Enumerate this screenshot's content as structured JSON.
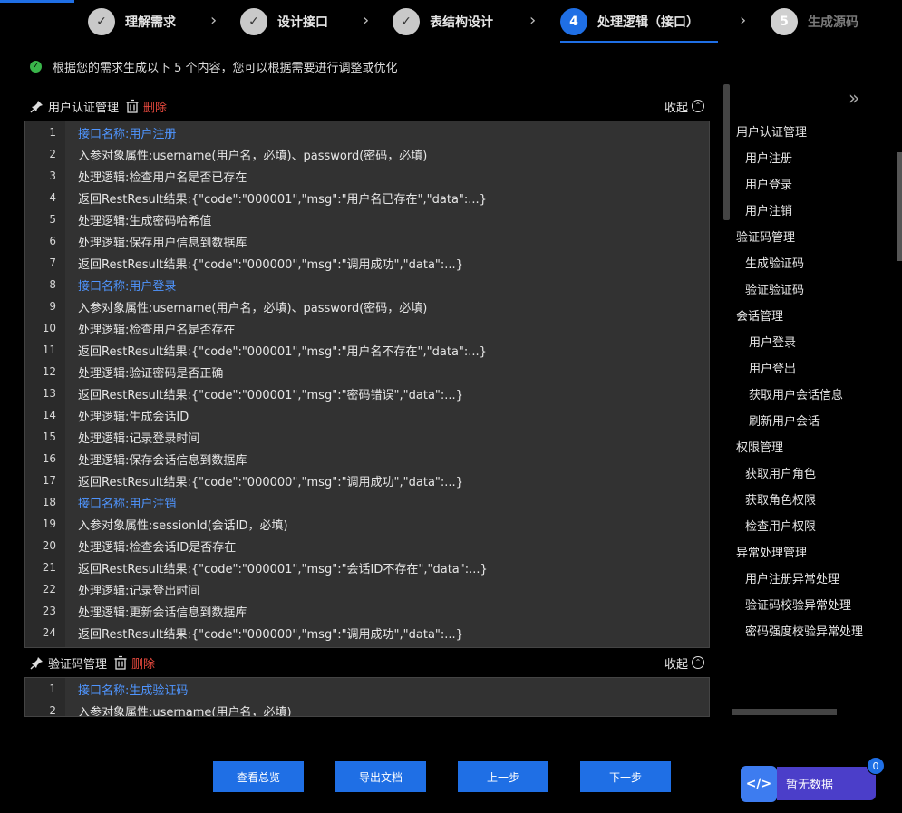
{
  "steps": [
    {
      "label": "理解需求",
      "state": "done"
    },
    {
      "label": "设计接口",
      "state": "done"
    },
    {
      "label": "表结构设计",
      "state": "done"
    },
    {
      "label": "处理逻辑（接口）",
      "state": "active",
      "number": "4"
    },
    {
      "label": "生成源码",
      "state": "todo",
      "number": "5"
    }
  ],
  "info": "根据您的需求生成以下 5 个内容，您可以根据需要进行调整或优化",
  "sections": [
    {
      "title": "用户认证管理",
      "delete_label": "删除",
      "collapse_label": "收起",
      "lines": [
        {
          "n": "1",
          "text": "接口名称:用户注册",
          "blue": true
        },
        {
          "n": "2",
          "text": "入参对象属性:username(用户名，必填)、password(密码，必填)"
        },
        {
          "n": "3",
          "text": "处理逻辑:检查用户名是否已存在"
        },
        {
          "n": "4",
          "text": "返回RestResult结果:{\"code\":\"000001\",\"msg\":\"用户名已存在\",\"data\":...}"
        },
        {
          "n": "5",
          "text": "处理逻辑:生成密码哈希值"
        },
        {
          "n": "6",
          "text": "处理逻辑:保存用户信息到数据库"
        },
        {
          "n": "7",
          "text": "返回RestResult结果:{\"code\":\"000000\",\"msg\":\"调用成功\",\"data\":...}"
        },
        {
          "n": "8",
          "text": "接口名称:用户登录",
          "blue": true
        },
        {
          "n": "9",
          "text": "入参对象属性:username(用户名，必填)、password(密码，必填)"
        },
        {
          "n": "10",
          "text": "处理逻辑:检查用户名是否存在"
        },
        {
          "n": "11",
          "text": "返回RestResult结果:{\"code\":\"000001\",\"msg\":\"用户名不存在\",\"data\":...}"
        },
        {
          "n": "12",
          "text": "处理逻辑:验证密码是否正确"
        },
        {
          "n": "13",
          "text": "返回RestResult结果:{\"code\":\"000001\",\"msg\":\"密码错误\",\"data\":...}"
        },
        {
          "n": "14",
          "text": "处理逻辑:生成会话ID"
        },
        {
          "n": "15",
          "text": "处理逻辑:记录登录时间"
        },
        {
          "n": "16",
          "text": "处理逻辑:保存会话信息到数据库"
        },
        {
          "n": "17",
          "text": "返回RestResult结果:{\"code\":\"000000\",\"msg\":\"调用成功\",\"data\":...}"
        },
        {
          "n": "18",
          "text": "接口名称:用户注销",
          "blue": true
        },
        {
          "n": "19",
          "text": "入参对象属性:sessionId(会话ID，必填)"
        },
        {
          "n": "20",
          "text": "处理逻辑:检查会话ID是否存在"
        },
        {
          "n": "21",
          "text": "返回RestResult结果:{\"code\":\"000001\",\"msg\":\"会话ID不存在\",\"data\":...}"
        },
        {
          "n": "22",
          "text": "处理逻辑:记录登出时间"
        },
        {
          "n": "23",
          "text": "处理逻辑:更新会话信息到数据库"
        },
        {
          "n": "24",
          "text": "返回RestResult结果:{\"code\":\"000000\",\"msg\":\"调用成功\",\"data\":...}"
        }
      ]
    },
    {
      "title": "验证码管理",
      "delete_label": "删除",
      "collapse_label": "收起",
      "lines": [
        {
          "n": "1",
          "text": "接口名称:生成验证码",
          "blue": true
        },
        {
          "n": "2",
          "text": "入参对象属性:username(用户名，必填)"
        }
      ]
    }
  ],
  "outline": [
    {
      "text": "用户认证管理",
      "level": 1
    },
    {
      "text": "用户注册",
      "level": 2
    },
    {
      "text": "用户登录",
      "level": 2
    },
    {
      "text": "用户注销",
      "level": 2
    },
    {
      "text": "验证码管理",
      "level": 1
    },
    {
      "text": "生成验证码",
      "level": 2
    },
    {
      "text": "验证验证码",
      "level": 2
    },
    {
      "text": "会话管理",
      "level": 1
    },
    {
      "text": "用户登录",
      "level": 3
    },
    {
      "text": "用户登出",
      "level": 3
    },
    {
      "text": "获取用户会话信息",
      "level": 3
    },
    {
      "text": "刷新用户会话",
      "level": 3
    },
    {
      "text": "权限管理",
      "level": 1
    },
    {
      "text": "获取用户角色",
      "level": 2
    },
    {
      "text": "获取角色权限",
      "level": 2
    },
    {
      "text": "检查用户权限",
      "level": 2
    },
    {
      "text": "异常处理管理",
      "level": 1
    },
    {
      "text": "用户注册异常处理",
      "level": 2
    },
    {
      "text": "验证码校验异常处理",
      "level": 2
    },
    {
      "text": "密码强度校验异常处理",
      "level": 2
    }
  ],
  "buttons": {
    "overview": "查看总览",
    "export": "导出文档",
    "prev": "上一步",
    "next": "下一步"
  },
  "widget": {
    "label": "暂无数据",
    "badge": "0",
    "icon": "code-icon"
  },
  "colors": {
    "accent": "#1f6fe5",
    "link": "#4f95ff",
    "danger": "#e5483d",
    "success": "#39b54a"
  }
}
